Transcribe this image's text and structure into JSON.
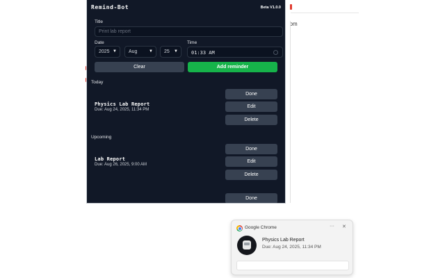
{
  "background_page": {
    "fragment_text": "ɔm"
  },
  "popup": {
    "app_title": "Remind-Bot",
    "version": "Beta V1.0.0",
    "form": {
      "title_label": "Title",
      "title_placeholder": "Print lab report",
      "date_label": "Date",
      "year": "2025",
      "month": "Aug",
      "day": "25",
      "time_label": "Time",
      "time_value": "01:33 AM",
      "clear_button": "Clear",
      "add_button": "Add reminder"
    },
    "sections": {
      "today_label": "Today",
      "upcoming_label": "Upcoming"
    },
    "today_items": [
      {
        "title": "Physics Lab Report",
        "due": "Due: Aug 24, 2025, 11:34 PM",
        "done": "Done",
        "edit": "Edit",
        "delete": "Delete"
      }
    ],
    "upcoming_items": [
      {
        "title": "Lab Report",
        "due": "Due: Aug 26, 2025, 9:00 AM",
        "done": "Done",
        "edit": "Edit",
        "delete": "Delete"
      },
      {
        "done": "Done"
      }
    ]
  },
  "notification": {
    "app_name": "Google Chrome",
    "more_icon": "more-horizontal-icon",
    "close_icon": "close-icon",
    "title": "Physics Lab Report",
    "body": "Due: Aug 24, 2025, 11:34 PM"
  }
}
